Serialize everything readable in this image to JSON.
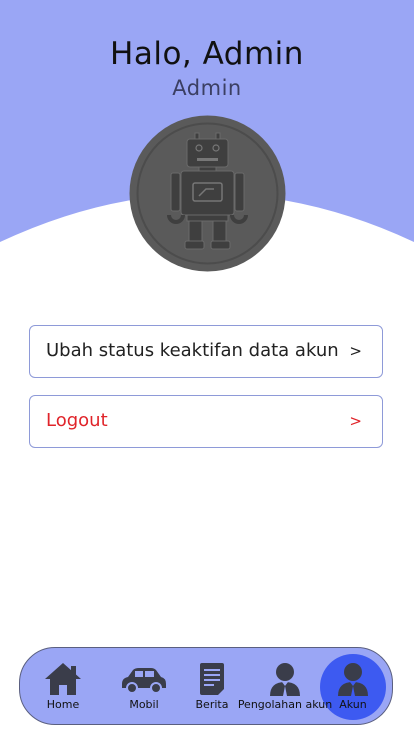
{
  "header": {
    "greeting": "Halo, Admin",
    "role": "Admin",
    "background_color": "#9aa6f5"
  },
  "avatar": {
    "icon": "robot-icon",
    "color": "#5a5a5a"
  },
  "menu": {
    "items": [
      {
        "label": "Ubah status keaktifan data akun",
        "arrow": ">"
      },
      {
        "label": "Logout",
        "arrow": ">",
        "color": "#e0242a"
      }
    ]
  },
  "bottom_nav": {
    "active_color": "#3d5af1",
    "items": [
      {
        "label": "Home",
        "icon": "home-icon"
      },
      {
        "label": "Mobil",
        "icon": "car-icon"
      },
      {
        "label": "Berita",
        "icon": "news-icon"
      },
      {
        "label": "Pengolahan akun",
        "icon": "person-icon"
      },
      {
        "label": "Akun",
        "icon": "person-icon",
        "active": true
      }
    ]
  }
}
